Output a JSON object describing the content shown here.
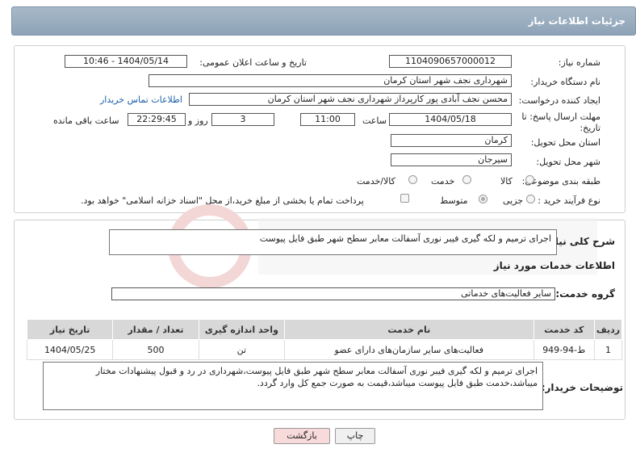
{
  "panel_title": "جزئیات اطلاعات نیاز",
  "fields": {
    "need_number_label": "شماره نیاز:",
    "need_number": "1104090657000012",
    "announce_label": "تاریخ و ساعت اعلان عمومی:",
    "announce_value": "1404/05/14 - 10:46",
    "buyer_org_label": "نام دستگاه خریدار:",
    "buyer_org": "شهرداری نجف شهر استان کرمان",
    "creator_label": "ایجاد کننده درخواست:",
    "creator": "محسن نجف آبادی پور کارپرداز شهرداری نجف شهر استان کرمان",
    "contact_link": "اطلاعات تماس خریدار",
    "deadline_label": "مهلت ارسال پاسخ: تا تاریخ:",
    "deadline_date": "1404/05/18",
    "time_label": "ساعت",
    "deadline_time": "11:00",
    "days_value": "3",
    "days_label": "روز و",
    "remaining_time": "22:29:45",
    "remaining_label": "ساعت باقی مانده",
    "province_label": "استان محل تحویل:",
    "province": "کرمان",
    "city_label": "شهر محل تحویل:",
    "city": "سیرجان",
    "category_label": "طبقه بندی موضوعی:",
    "category_options": [
      "کالا",
      "خدمت",
      "کالا/خدمت"
    ],
    "process_label": "نوع فرآیند خرید :",
    "process_options": [
      "جزیی",
      "متوسط"
    ],
    "payment_note": "پرداخت تمام یا بخشی از مبلغ خرید،از محل \"اسناد خزانه اسلامی\" خواهد بود."
  },
  "summary": {
    "label": "شرح کلی نیاز:",
    "text": "اجرای ترمیم و لکه گیری فیبر نوری آسفالت معابر سطح شهر طبق فایل پیوست"
  },
  "services": {
    "section_title": "اطلاعات خدمات مورد نیاز",
    "group_label": "گروه خدمت:",
    "group_value": "سایر فعالیت‌های خدماتی",
    "columns": [
      "ردیف",
      "کد خدمت",
      "نام خدمت",
      "واحد اندازه گیری",
      "تعداد / مقدار",
      "تاریخ نیاز"
    ],
    "rows": [
      [
        "1",
        "ط-94-949",
        "فعالیت‌های سایر سازمان‌های دارای عضو",
        "تن",
        "500",
        "1404/05/25"
      ]
    ]
  },
  "buyer_notes": {
    "label": "توضیحات خریدار:",
    "text": "اجرای ترمیم و لکه گیری فیبر نوری آسفالت معابر سطح شهر طبق فایل پیوست،شهرداری در رد و قبول پیشنهادات مختار میباشد،خدمت طبق فایل پیوست میباشد،قیمت به صورت جمع کل وارد گردد."
  },
  "buttons": {
    "print": "چاپ",
    "back": "بازگشت"
  },
  "colors": {
    "header": "#8ea3b7",
    "link": "#1a5ea8",
    "back_button_bg": "#f8dada"
  }
}
